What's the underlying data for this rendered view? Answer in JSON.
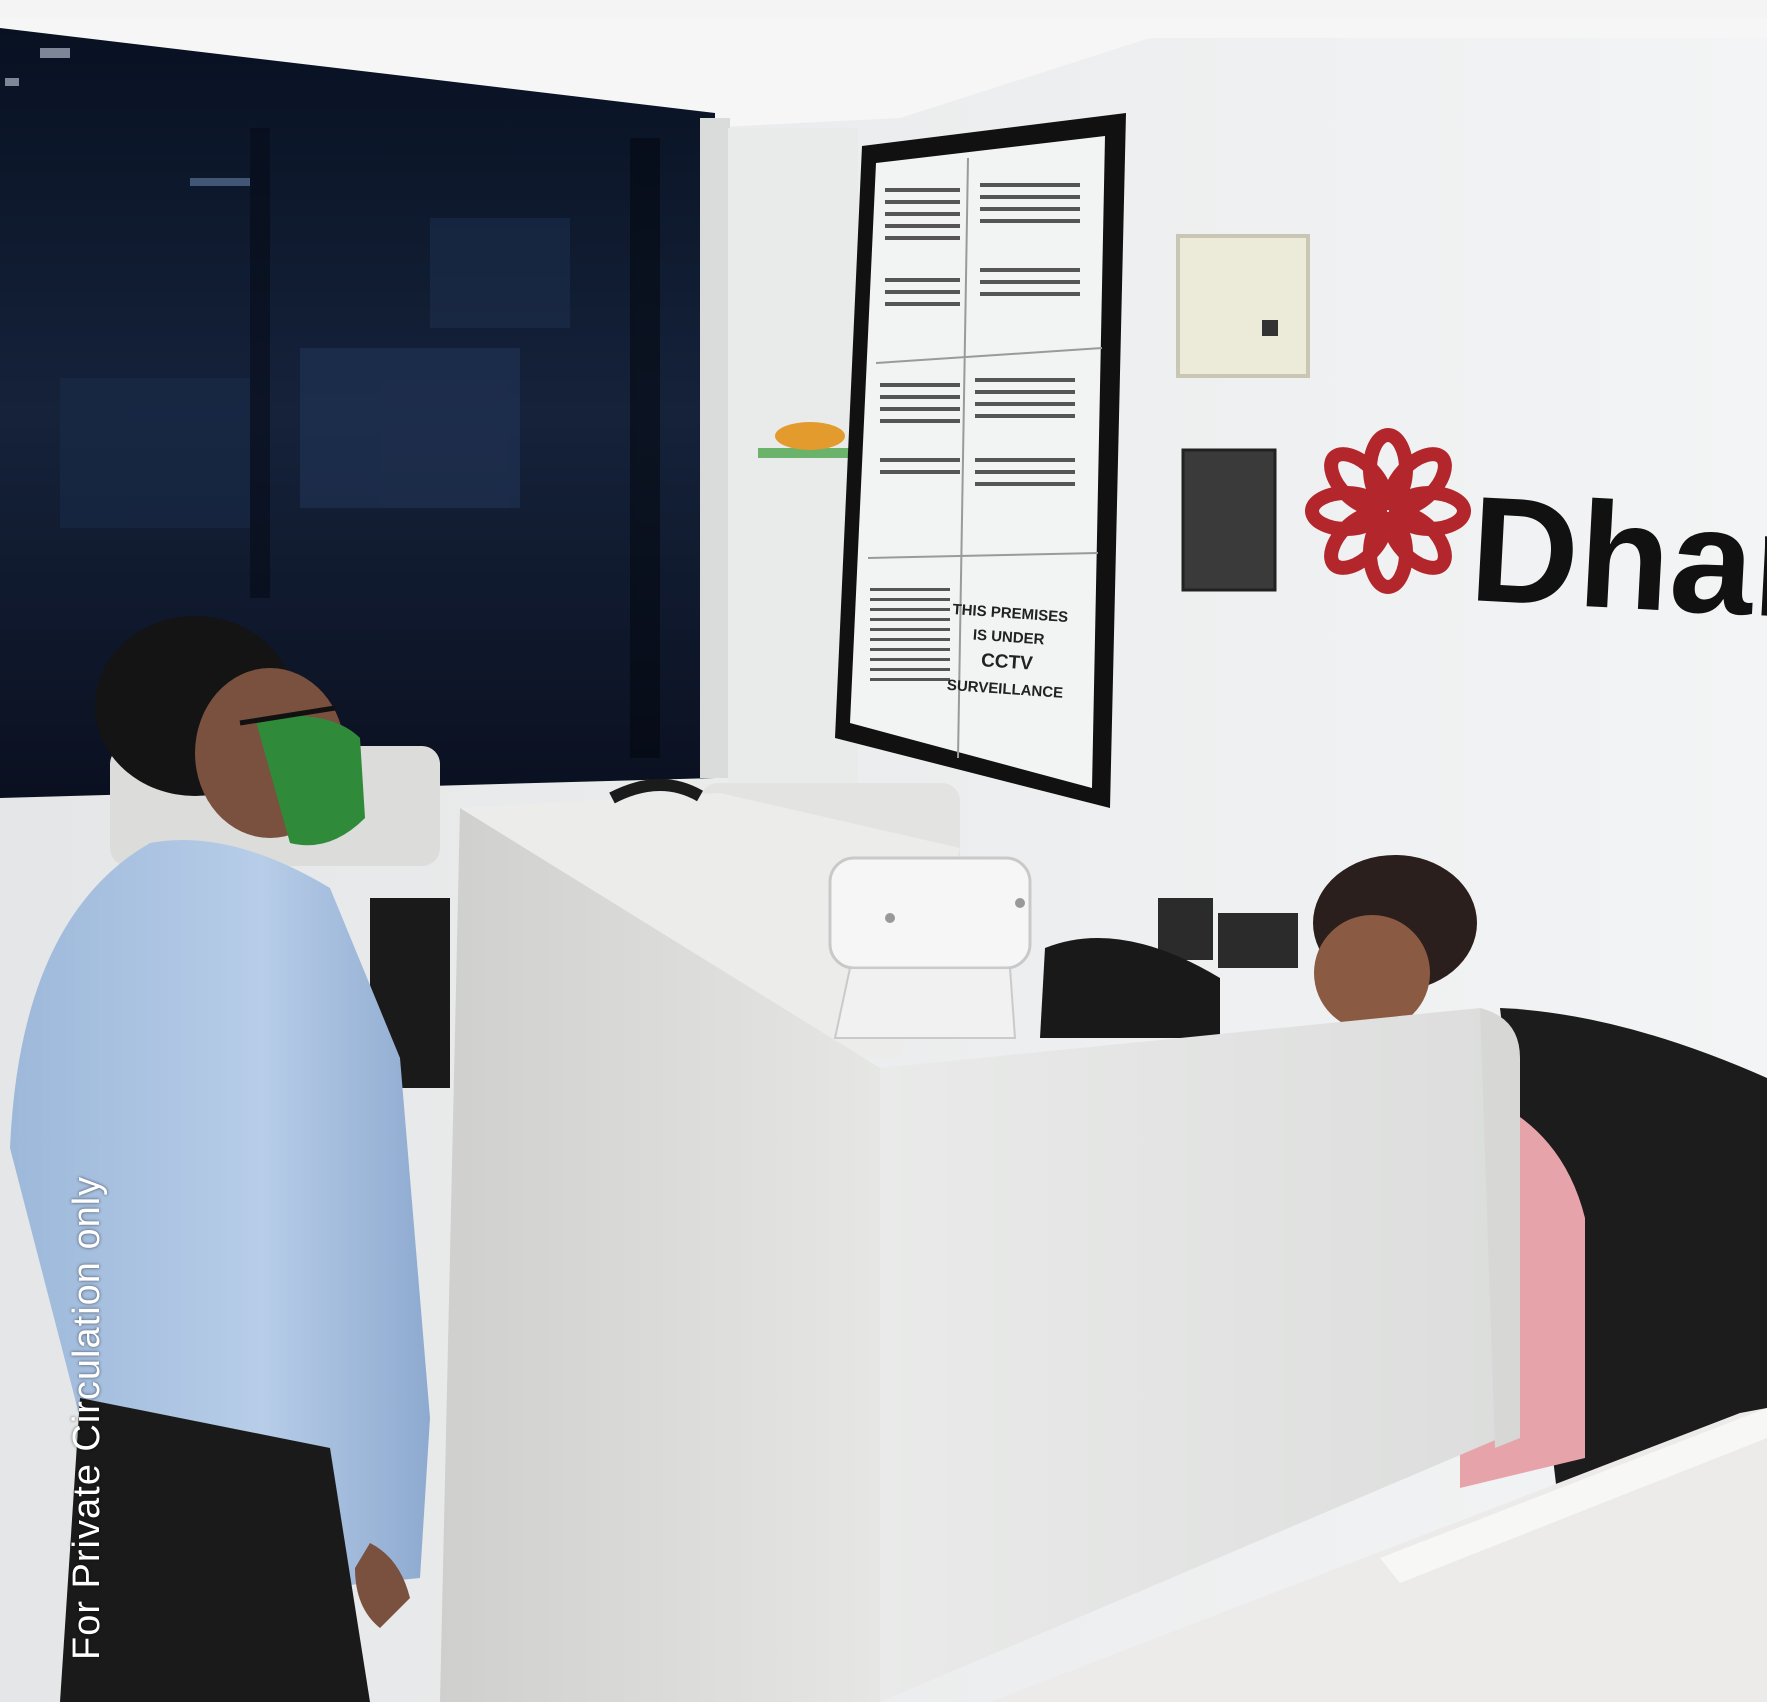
{
  "caption": "For Private Circulation only",
  "wall_logo": {
    "wordmark": "Dhan",
    "emblem_color": "#b3262c",
    "text_color": "#111111"
  },
  "notice_board": {
    "cctv_notice": [
      "THIS PREMISES",
      "IS UNDER",
      "CCTV",
      "SURVEILLANCE"
    ]
  },
  "colors": {
    "wall": "#eef0f1",
    "counter": "#e8e9e8",
    "window": "#0c1426",
    "shirt_blue": "#a9c3e2",
    "mask_green": "#2f8a3a"
  }
}
